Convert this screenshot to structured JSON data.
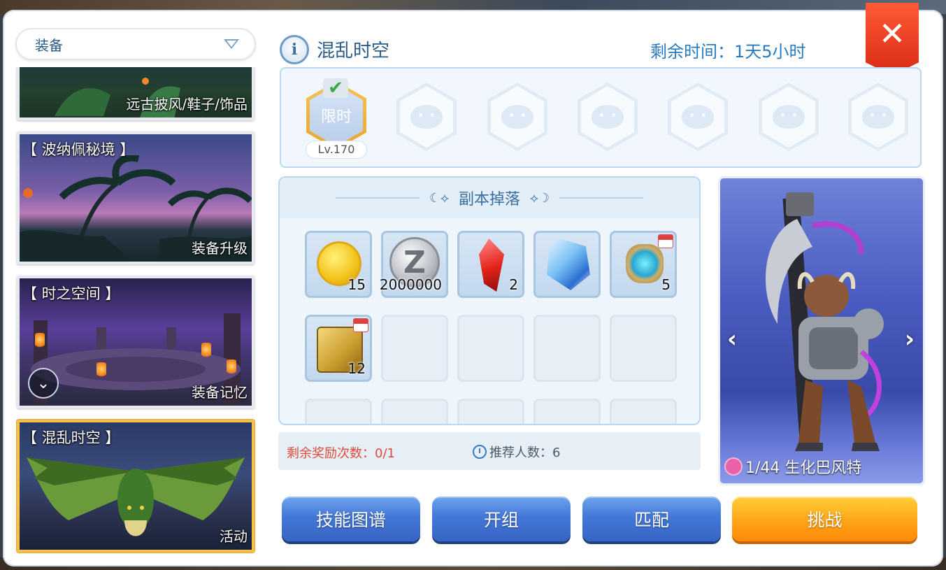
{
  "sidebar": {
    "dropdown_label": "装备",
    "cards": [
      {
        "title": "",
        "tag": "远古披风/鞋子/饰品"
      },
      {
        "title": "【 波纳佩秘境 】",
        "tag": "装备升级"
      },
      {
        "title": "【 时之空间 】",
        "tag": "装备记忆"
      },
      {
        "title": "【 混乱时空 】",
        "tag": "活动"
      }
    ]
  },
  "header": {
    "title": "混乱时空",
    "remaining_time": "剩余时间：1天5小时",
    "close_label": "✕"
  },
  "difficulty": {
    "active_label": "限时",
    "level": "Lv.170"
  },
  "drops": {
    "title": "副本掉落",
    "items": [
      {
        "icon": "cat-coin-icon",
        "count": "15"
      },
      {
        "icon": "zeny-coin-icon",
        "count": "2000000"
      },
      {
        "icon": "red-crystal-icon",
        "count": "2"
      },
      {
        "icon": "blue-crystal-icon",
        "count": ""
      },
      {
        "icon": "relic-gem-icon",
        "count": "5"
      },
      {
        "icon": "gold-box-icon",
        "count": "12"
      }
    ]
  },
  "footer": {
    "remaining_rewards": "剩余奖励次数：0/1",
    "recommended": "推荐人数：6"
  },
  "boss": {
    "name": "1/44 生化巴风特",
    "prev": "‹",
    "next": "›"
  },
  "buttons": {
    "skill": "技能图谱",
    "team": "开组",
    "match": "匹配",
    "challenge": "挑战"
  },
  "colors": {
    "accent_blue": "#2a5c8a",
    "close_red": "#e23a1e",
    "challenge_orange": "#ffa416",
    "active_gold": "#f5c14a"
  }
}
